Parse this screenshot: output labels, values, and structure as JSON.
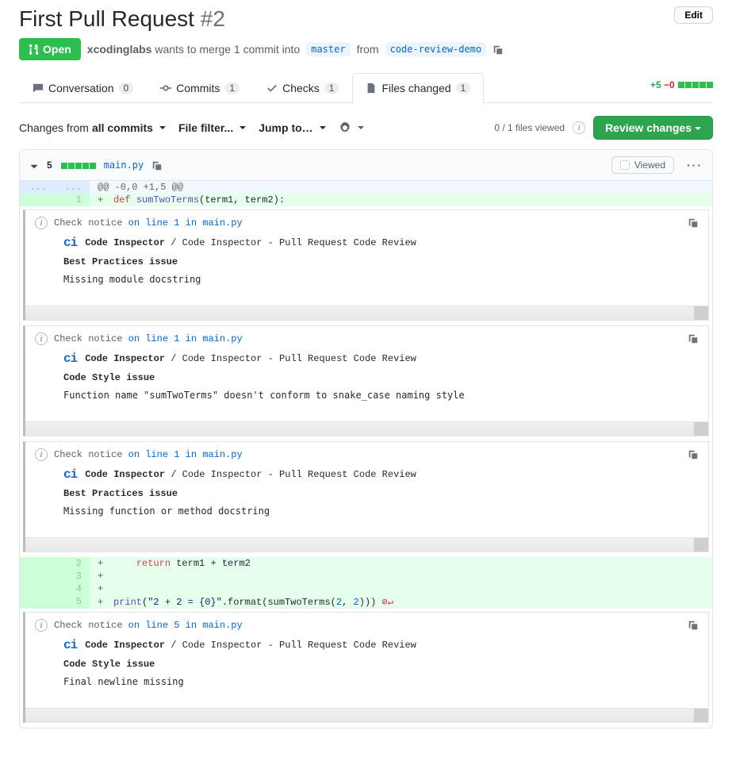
{
  "header": {
    "title": "First Pull Request",
    "number": "#2",
    "edit": "Edit"
  },
  "state": {
    "label": "Open"
  },
  "meta": {
    "author": "xcodinglabs",
    "merge_text": "wants to merge 1 commit into",
    "base": "master",
    "from_text": "from",
    "head": "code-review-demo"
  },
  "tabs": {
    "conversation": {
      "label": "Conversation",
      "count": "0"
    },
    "commits": {
      "label": "Commits",
      "count": "1"
    },
    "checks": {
      "label": "Checks",
      "count": "1"
    },
    "files": {
      "label": "Files changed",
      "count": "1"
    }
  },
  "diffstat": {
    "add": "+5",
    "del": "−0"
  },
  "toolbar": {
    "changes_from_label": "Changes from",
    "changes_from_value": "all commits",
    "file_filter": "File filter...",
    "jump_to": "Jump to…",
    "viewed_count": "0 / 1 files viewed",
    "review": "Review changes"
  },
  "file": {
    "lines_changed": "5",
    "name": "main.py",
    "viewed_label": "Viewed"
  },
  "hunk": "@@ -0,0 +1,5 @@",
  "code": {
    "l1": {
      "num": "1",
      "def": "def",
      "fn": "sumTwoTerms",
      "rest": "(term1, term2):"
    },
    "l2": {
      "num": "2",
      "ret": "return",
      "rest": " term1 + term2"
    },
    "l3": {
      "num": "3"
    },
    "l4": {
      "num": "4"
    },
    "l5": {
      "num": "5",
      "print": "print",
      "open": "(",
      "str": "\"2 + 2 = {0}\"",
      "fmt": ".format(sumTwoTerms(",
      "a1": "2",
      "comma": ", ",
      "a2": "2",
      "close": ")))"
    }
  },
  "annotations": [
    {
      "head_prefix": "Check notice",
      "head_rest": "on line 1 in main.py",
      "source": "Code Inspector",
      "source_rest": "/ Code Inspector - Pull Request Code Review",
      "issue_title": "Best Practices issue",
      "message": "Missing module docstring"
    },
    {
      "head_prefix": "Check notice",
      "head_rest": "on line 1 in main.py",
      "source": "Code Inspector",
      "source_rest": "/ Code Inspector - Pull Request Code Review",
      "issue_title": "Code Style issue",
      "message": "Function name \"sumTwoTerms\" doesn't conform to snake_case naming style"
    },
    {
      "head_prefix": "Check notice",
      "head_rest": "on line 1 in main.py",
      "source": "Code Inspector",
      "source_rest": "/ Code Inspector - Pull Request Code Review",
      "issue_title": "Best Practices issue",
      "message": "Missing function or method docstring"
    },
    {
      "head_prefix": "Check notice",
      "head_rest": "on line 5 in main.py",
      "source": "Code Inspector",
      "source_rest": "/ Code Inspector - Pull Request Code Review",
      "issue_title": "Code Style issue",
      "message": "Final newline missing"
    }
  ]
}
